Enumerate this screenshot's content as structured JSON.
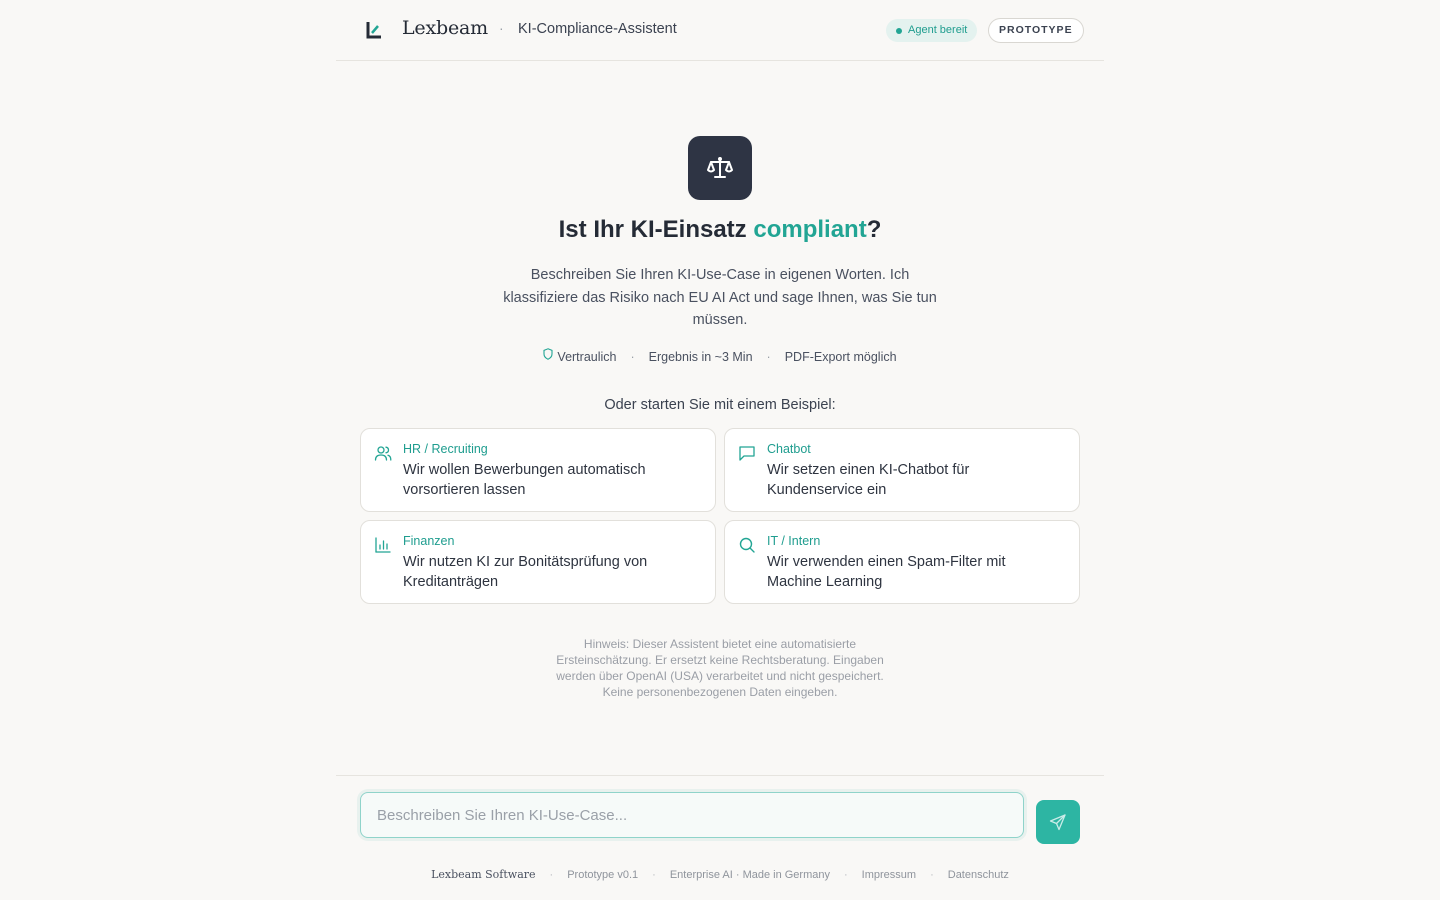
{
  "header": {
    "brand": "Lexbeam",
    "separator": "·",
    "app_title": "KI-Compliance-Assistent",
    "status_badge": "Agent bereit",
    "prototype_badge": "PROTOTYPE"
  },
  "hero": {
    "icon": "scale-icon",
    "title_prefix": "Ist Ihr KI-Einsatz ",
    "title_accent": "compliant",
    "title_suffix": "?",
    "description": "Beschreiben Sie Ihren KI-Use-Case in eigenen Worten. Ich klassifiziere das Risiko nach EU AI Act und sage Ihnen, was Sie tun müssen.",
    "meta": {
      "item1": "Vertraulich",
      "item2": "Ergebnis in ~3 Min",
      "item3": "PDF-Export möglich",
      "sep": "·"
    }
  },
  "examples": {
    "label": "Oder starten Sie mit einem Beispiel:",
    "cards": [
      {
        "icon": "users-icon",
        "category": "HR / Recruiting",
        "text": "Wir wollen Bewerbungen automatisch vorsortieren lassen"
      },
      {
        "icon": "chat-icon",
        "category": "Chatbot",
        "text": "Wir setzen einen KI-Chatbot für Kundenservice ein"
      },
      {
        "icon": "bar-chart-icon",
        "category": "Finanzen",
        "text": "Wir nutzen KI zur Bonitätsprüfung von Kreditanträgen"
      },
      {
        "icon": "search-icon",
        "category": "IT / Intern",
        "text": "Wir verwenden einen Spam-Filter mit Machine Learning"
      }
    ]
  },
  "note": "Hinweis: Dieser Assistent bietet eine automatisierte Ersteinschätzung. Er ersetzt keine Rechtsberatung. Eingaben werden über OpenAI (USA) verarbeitet und nicht gespeichert. Keine personenbezogenen Daten eingeben.",
  "input": {
    "placeholder": "Beschreiben Sie Ihren KI-Use-Case...",
    "value": ""
  },
  "footer": {
    "brand": "Lexbeam Software",
    "version": "Prototype v0.1",
    "tagline": "Enterprise AI · Made in Germany",
    "impressum": "Impressum",
    "datenschutz": "Datenschutz",
    "sep": "·"
  },
  "colors": {
    "accent": "#22a594",
    "dark": "#2e3444",
    "background": "#f9f8f6"
  }
}
